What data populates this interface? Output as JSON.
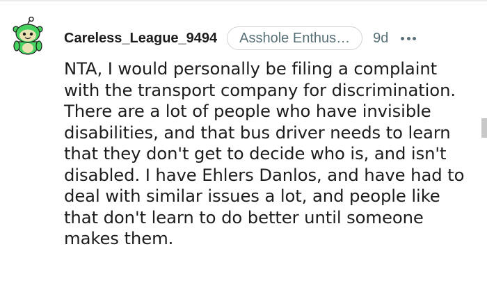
{
  "comment": {
    "username": "Careless_League_9494",
    "flair": "Asshole Enthus…",
    "age": "9d",
    "body": "NTA, I would personally be filing a complaint with the transport company for discrimination. There are a lot of people who have invisible disabilities, and that bus driver needs to learn that they don't get to decide who is, and isn't disabled. I have Ehlers Danlos, and have had to deal with similar issues a lot, and people like that don't learn to do better until someone makes them."
  },
  "icons": {
    "avatar": "snoo-avatar-icon",
    "more": "more-options-icon"
  },
  "colors": {
    "text": "#1c1c1c",
    "meta": "#576f76",
    "flair_border": "#d2d2d2",
    "avatar_green": "#46d160",
    "avatar_cream": "#ebe2b4"
  }
}
